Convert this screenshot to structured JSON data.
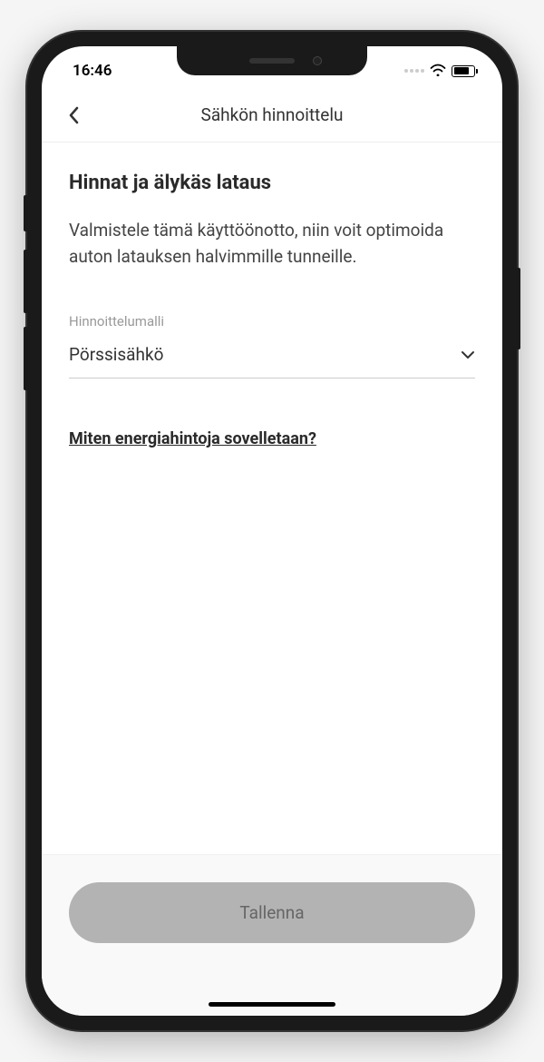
{
  "statusBar": {
    "time": "16:46"
  },
  "nav": {
    "title": "Sähkön hinnoittelu"
  },
  "section": {
    "title": "Hinnat ja älykäs lataus",
    "description": "Valmistele tämä käyttöönotto, niin voit optimoida auton latauksen halvimmille tunneille."
  },
  "pricingModel": {
    "label": "Hinnoittelumalli",
    "value": "Pörssisähkö"
  },
  "helpLink": {
    "text": "Miten energiahintoja sovelletaan?"
  },
  "saveButton": {
    "label": "Tallenna"
  }
}
